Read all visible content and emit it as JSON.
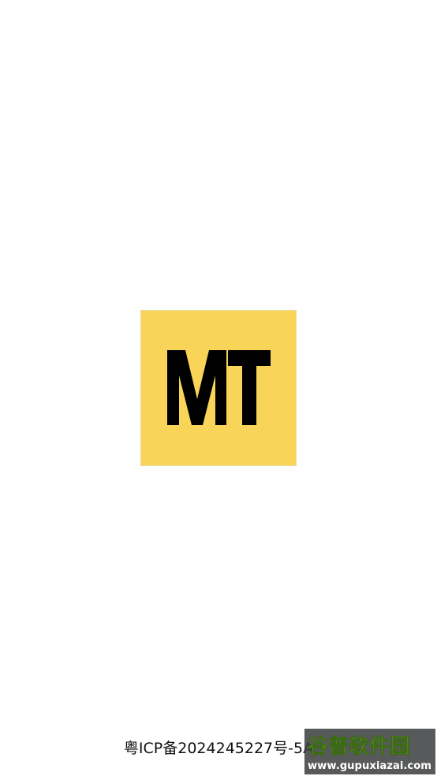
{
  "splash": {
    "logo_text": "MT",
    "logo_bg": "#f8d558",
    "logo_fg": "#000000"
  },
  "footer": {
    "icp_text": "粤ICP备2024245227号-5A"
  },
  "watermark": {
    "brand": "谷普软件园",
    "url": "www.gupuxiazai.com"
  }
}
